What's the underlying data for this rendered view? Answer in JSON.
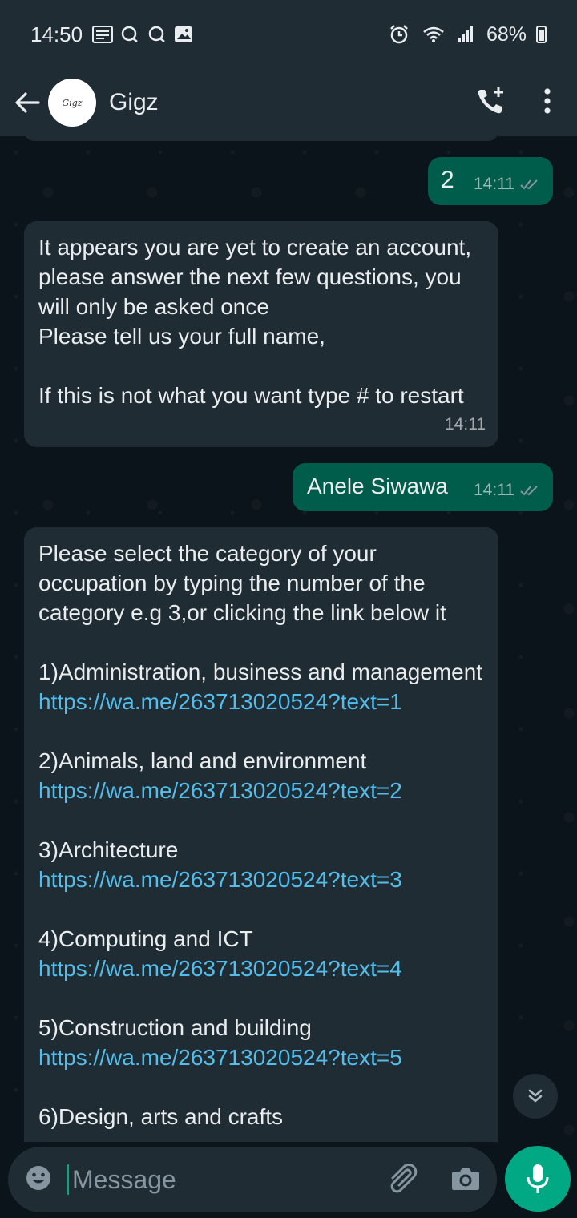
{
  "status_bar": {
    "time": "14:50",
    "battery": "68%"
  },
  "header": {
    "contact_name": "Gigz",
    "avatar_text": "Gigz"
  },
  "messages": [
    {
      "direction": "out",
      "text": "2",
      "time": "14:11"
    },
    {
      "direction": "in",
      "text": "It appears you are yet to create an account, please answer the next few questions, you will only be asked once\nPlease tell us your full name,\n\nIf this is not what you want type # to restart",
      "time": "14:11"
    },
    {
      "direction": "out",
      "text": "Anele Siwawa",
      "time": "14:11"
    },
    {
      "direction": "in",
      "intro": "Please select the category of your occupation by typing the number of the category e.g 3,or clicking the link below it",
      "items": [
        {
          "label": "1)Administration, business and management",
          "link": "https://wa.me/263713020524?text=1"
        },
        {
          "label": "2)Animals, land and environment",
          "link": "https://wa.me/263713020524?text=2"
        },
        {
          "label": "3)Architecture",
          "link": "https://wa.me/263713020524?text=3"
        },
        {
          "label": "4)Computing and ICT",
          "link": "https://wa.me/263713020524?text=4"
        },
        {
          "label": "5)Construction and building",
          "link": "https://wa.me/263713020524?text=5"
        },
        {
          "label": "6)Design, arts and crafts",
          "link": ""
        }
      ]
    }
  ],
  "composer": {
    "placeholder": "Message"
  },
  "icons": {
    "back": "arrow-left-icon",
    "add_call": "phone-plus-icon",
    "menu": "more-vertical-icon",
    "emoji": "emoji-icon",
    "attach": "paperclip-icon",
    "camera": "camera-icon",
    "mic": "mic-icon",
    "scroll_down": "double-chevron-down-icon"
  },
  "colors": {
    "header_bg": "#1f2c34",
    "chat_bg": "#0b141a",
    "incoming_bubble": "#202c33",
    "outgoing_bubble": "#005c4b",
    "link": "#53bdeb",
    "accent": "#00a884"
  }
}
